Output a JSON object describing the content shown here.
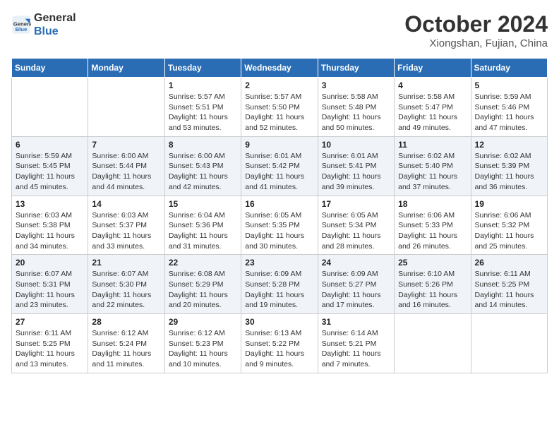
{
  "header": {
    "logo_line1": "General",
    "logo_line2": "Blue",
    "month": "October 2024",
    "location": "Xiongshan, Fujian, China"
  },
  "weekdays": [
    "Sunday",
    "Monday",
    "Tuesday",
    "Wednesday",
    "Thursday",
    "Friday",
    "Saturday"
  ],
  "weeks": [
    [
      {
        "day": "",
        "sunrise": "",
        "sunset": "",
        "daylight": ""
      },
      {
        "day": "",
        "sunrise": "",
        "sunset": "",
        "daylight": ""
      },
      {
        "day": "1",
        "sunrise": "Sunrise: 5:57 AM",
        "sunset": "Sunset: 5:51 PM",
        "daylight": "Daylight: 11 hours and 53 minutes."
      },
      {
        "day": "2",
        "sunrise": "Sunrise: 5:57 AM",
        "sunset": "Sunset: 5:50 PM",
        "daylight": "Daylight: 11 hours and 52 minutes."
      },
      {
        "day": "3",
        "sunrise": "Sunrise: 5:58 AM",
        "sunset": "Sunset: 5:48 PM",
        "daylight": "Daylight: 11 hours and 50 minutes."
      },
      {
        "day": "4",
        "sunrise": "Sunrise: 5:58 AM",
        "sunset": "Sunset: 5:47 PM",
        "daylight": "Daylight: 11 hours and 49 minutes."
      },
      {
        "day": "5",
        "sunrise": "Sunrise: 5:59 AM",
        "sunset": "Sunset: 5:46 PM",
        "daylight": "Daylight: 11 hours and 47 minutes."
      }
    ],
    [
      {
        "day": "6",
        "sunrise": "Sunrise: 5:59 AM",
        "sunset": "Sunset: 5:45 PM",
        "daylight": "Daylight: 11 hours and 45 minutes."
      },
      {
        "day": "7",
        "sunrise": "Sunrise: 6:00 AM",
        "sunset": "Sunset: 5:44 PM",
        "daylight": "Daylight: 11 hours and 44 minutes."
      },
      {
        "day": "8",
        "sunrise": "Sunrise: 6:00 AM",
        "sunset": "Sunset: 5:43 PM",
        "daylight": "Daylight: 11 hours and 42 minutes."
      },
      {
        "day": "9",
        "sunrise": "Sunrise: 6:01 AM",
        "sunset": "Sunset: 5:42 PM",
        "daylight": "Daylight: 11 hours and 41 minutes."
      },
      {
        "day": "10",
        "sunrise": "Sunrise: 6:01 AM",
        "sunset": "Sunset: 5:41 PM",
        "daylight": "Daylight: 11 hours and 39 minutes."
      },
      {
        "day": "11",
        "sunrise": "Sunrise: 6:02 AM",
        "sunset": "Sunset: 5:40 PM",
        "daylight": "Daylight: 11 hours and 37 minutes."
      },
      {
        "day": "12",
        "sunrise": "Sunrise: 6:02 AM",
        "sunset": "Sunset: 5:39 PM",
        "daylight": "Daylight: 11 hours and 36 minutes."
      }
    ],
    [
      {
        "day": "13",
        "sunrise": "Sunrise: 6:03 AM",
        "sunset": "Sunset: 5:38 PM",
        "daylight": "Daylight: 11 hours and 34 minutes."
      },
      {
        "day": "14",
        "sunrise": "Sunrise: 6:03 AM",
        "sunset": "Sunset: 5:37 PM",
        "daylight": "Daylight: 11 hours and 33 minutes."
      },
      {
        "day": "15",
        "sunrise": "Sunrise: 6:04 AM",
        "sunset": "Sunset: 5:36 PM",
        "daylight": "Daylight: 11 hours and 31 minutes."
      },
      {
        "day": "16",
        "sunrise": "Sunrise: 6:05 AM",
        "sunset": "Sunset: 5:35 PM",
        "daylight": "Daylight: 11 hours and 30 minutes."
      },
      {
        "day": "17",
        "sunrise": "Sunrise: 6:05 AM",
        "sunset": "Sunset: 5:34 PM",
        "daylight": "Daylight: 11 hours and 28 minutes."
      },
      {
        "day": "18",
        "sunrise": "Sunrise: 6:06 AM",
        "sunset": "Sunset: 5:33 PM",
        "daylight": "Daylight: 11 hours and 26 minutes."
      },
      {
        "day": "19",
        "sunrise": "Sunrise: 6:06 AM",
        "sunset": "Sunset: 5:32 PM",
        "daylight": "Daylight: 11 hours and 25 minutes."
      }
    ],
    [
      {
        "day": "20",
        "sunrise": "Sunrise: 6:07 AM",
        "sunset": "Sunset: 5:31 PM",
        "daylight": "Daylight: 11 hours and 23 minutes."
      },
      {
        "day": "21",
        "sunrise": "Sunrise: 6:07 AM",
        "sunset": "Sunset: 5:30 PM",
        "daylight": "Daylight: 11 hours and 22 minutes."
      },
      {
        "day": "22",
        "sunrise": "Sunrise: 6:08 AM",
        "sunset": "Sunset: 5:29 PM",
        "daylight": "Daylight: 11 hours and 20 minutes."
      },
      {
        "day": "23",
        "sunrise": "Sunrise: 6:09 AM",
        "sunset": "Sunset: 5:28 PM",
        "daylight": "Daylight: 11 hours and 19 minutes."
      },
      {
        "day": "24",
        "sunrise": "Sunrise: 6:09 AM",
        "sunset": "Sunset: 5:27 PM",
        "daylight": "Daylight: 11 hours and 17 minutes."
      },
      {
        "day": "25",
        "sunrise": "Sunrise: 6:10 AM",
        "sunset": "Sunset: 5:26 PM",
        "daylight": "Daylight: 11 hours and 16 minutes."
      },
      {
        "day": "26",
        "sunrise": "Sunrise: 6:11 AM",
        "sunset": "Sunset: 5:25 PM",
        "daylight": "Daylight: 11 hours and 14 minutes."
      }
    ],
    [
      {
        "day": "27",
        "sunrise": "Sunrise: 6:11 AM",
        "sunset": "Sunset: 5:25 PM",
        "daylight": "Daylight: 11 hours and 13 minutes."
      },
      {
        "day": "28",
        "sunrise": "Sunrise: 6:12 AM",
        "sunset": "Sunset: 5:24 PM",
        "daylight": "Daylight: 11 hours and 11 minutes."
      },
      {
        "day": "29",
        "sunrise": "Sunrise: 6:12 AM",
        "sunset": "Sunset: 5:23 PM",
        "daylight": "Daylight: 11 hours and 10 minutes."
      },
      {
        "day": "30",
        "sunrise": "Sunrise: 6:13 AM",
        "sunset": "Sunset: 5:22 PM",
        "daylight": "Daylight: 11 hours and 9 minutes."
      },
      {
        "day": "31",
        "sunrise": "Sunrise: 6:14 AM",
        "sunset": "Sunset: 5:21 PM",
        "daylight": "Daylight: 11 hours and 7 minutes."
      },
      {
        "day": "",
        "sunrise": "",
        "sunset": "",
        "daylight": ""
      },
      {
        "day": "",
        "sunrise": "",
        "sunset": "",
        "daylight": ""
      }
    ]
  ]
}
